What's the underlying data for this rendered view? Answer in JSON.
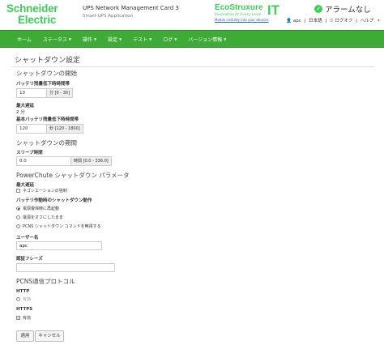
{
  "header": {
    "brand_line1": "Schneider",
    "brand_line2": "Electric",
    "product_name": "UPS Network Management Card 3",
    "product_sub": "Smart-UPS Application",
    "eco_title": "EcoStruxure",
    "eco_tagline": "Innovation At Every Level",
    "eco_link": "Mobile visibility into your devices",
    "it_label": "IT",
    "alarm_text": "アラームなし",
    "user_link": "apc",
    "language_link": "日本語",
    "logoff_link": "ログオフ",
    "help_link": "ヘルプ",
    "separator": "|"
  },
  "nav": {
    "items": [
      {
        "label": "ホーム",
        "dropdown": false
      },
      {
        "label": "ステータス",
        "dropdown": true
      },
      {
        "label": "操作",
        "dropdown": true
      },
      {
        "label": "設定",
        "dropdown": true
      },
      {
        "label": "テスト",
        "dropdown": true
      },
      {
        "label": "ログ",
        "dropdown": true
      },
      {
        "label": "バージョン情報",
        "dropdown": true
      }
    ],
    "caret": "▼"
  },
  "page": {
    "title": "シャットダウン設定",
    "section_start": "シャットダウンの開始",
    "battery_low_label": "バッテリ残量低下時時間帯",
    "battery_low_value": "10",
    "battery_low_unit": "分 [0 - 30]",
    "max_delay_label": "最大遅延",
    "max_delay_value": "2 分",
    "basic_low_label": "基本バッテリ残量低下時時間帯",
    "basic_low_value": "120",
    "basic_low_unit": "秒 [120 - 1800]",
    "section_period": "シャットダウンの期間",
    "sleep_label": "スリープ時間",
    "sleep_value": "0.0",
    "sleep_unit": "時間 [0.0 - 336.0]",
    "section_powerchute": "PowerChute シャットダウン パラメータ",
    "max_delay2_label": "最大遅延",
    "negotiation_label": "ネゴシエーションの強制",
    "battery_op_label": "バッテリ作動時のシャットダウン動作",
    "radio_restart": "電源復帰時に再起動",
    "radio_power_off": "電源をオフにしたまま",
    "radio_pcns": "PCNS シャットダウン コマンドを無視する",
    "user_name_label": "ユーザー名",
    "user_name_value": "apc",
    "auth_phrase_label": "認証フレーズ",
    "auth_phrase_value": "",
    "section_protocol": "PCNS通信プロトコル",
    "http_label": "HTTP",
    "http_option": "有効",
    "https_label": "HTTPS",
    "https_option": "有効",
    "https_check": "✓",
    "apply_button": "適用",
    "cancel_button": "キャンセル"
  }
}
